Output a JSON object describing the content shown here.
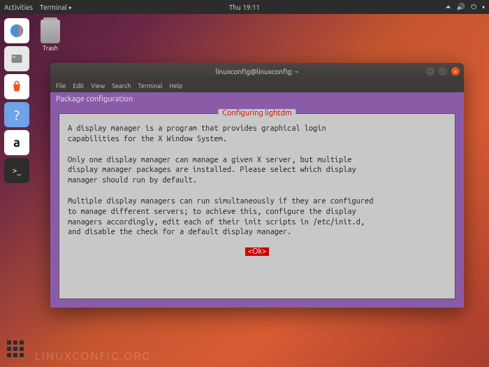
{
  "topbar": {
    "activities": "Activities",
    "app": "Terminal",
    "time": "Thu 19:11"
  },
  "desktop": {
    "trash_label": "Trash"
  },
  "window": {
    "title": "linuxconfig@linuxconfig: ~"
  },
  "menubar": {
    "items": [
      "File",
      "Edit",
      "View",
      "Search",
      "Terminal",
      "Help"
    ]
  },
  "terminal": {
    "pkg_header": "Package configuration",
    "dialog_title": "Configuring lightdm",
    "dialog_body": "A display manager is a program that provides graphical login\ncapabilities for the X Window System.\n\nOnly one display manager can manage a given X server, but multiple\ndisplay manager packages are installed. Please select which display\nmanager should run by default.\n\nMultiple display managers can run simultaneously if they are configured\nto manage different servers; to achieve this, configure the display\nmanagers accordingly, edit each of their init scripts in /etc/init.d,\nand disable the check for a default display manager.",
    "ok_label": "<Ok>"
  },
  "watermark": "LINUXCONFIG.ORG"
}
